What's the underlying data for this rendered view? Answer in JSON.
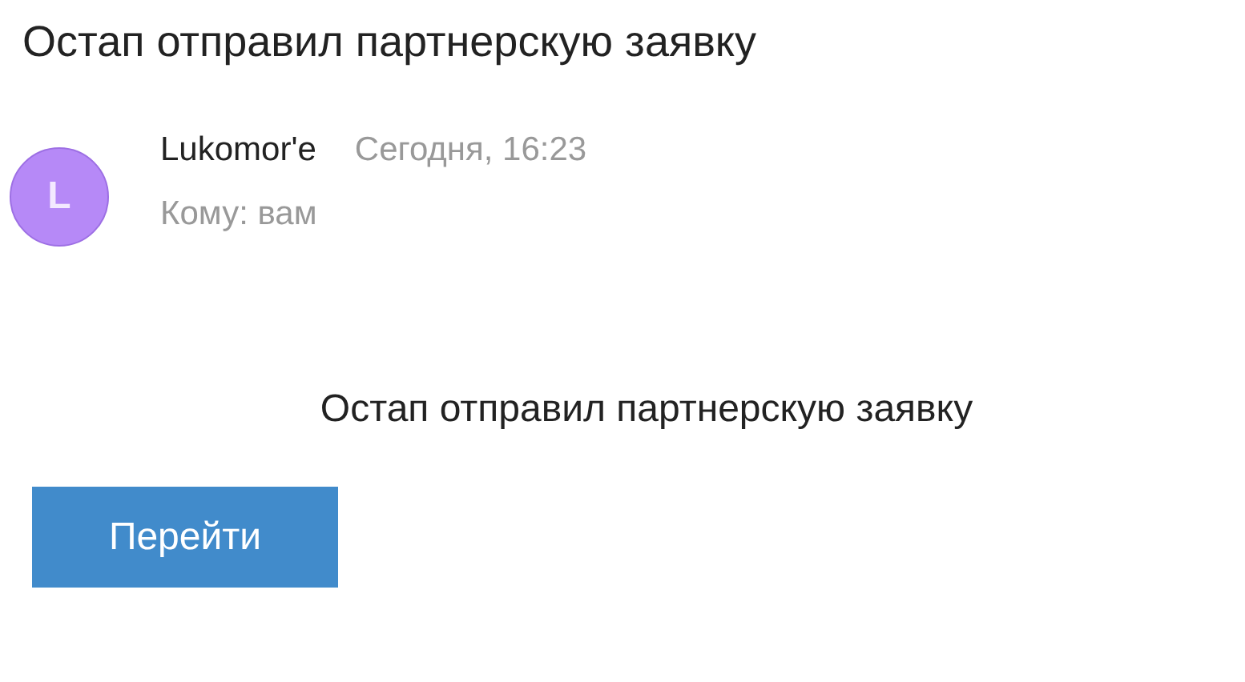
{
  "subject": "Остап отправил партнерскую заявку",
  "message": {
    "avatar": {
      "letter": "L",
      "color": "#b689f7"
    },
    "sender": "Lukomor'e",
    "date": "Сегодня, 16:23",
    "recipient": "Кому: вам"
  },
  "body": {
    "text": "Остап отправил партнерскую заявку",
    "button": "Перейти"
  }
}
